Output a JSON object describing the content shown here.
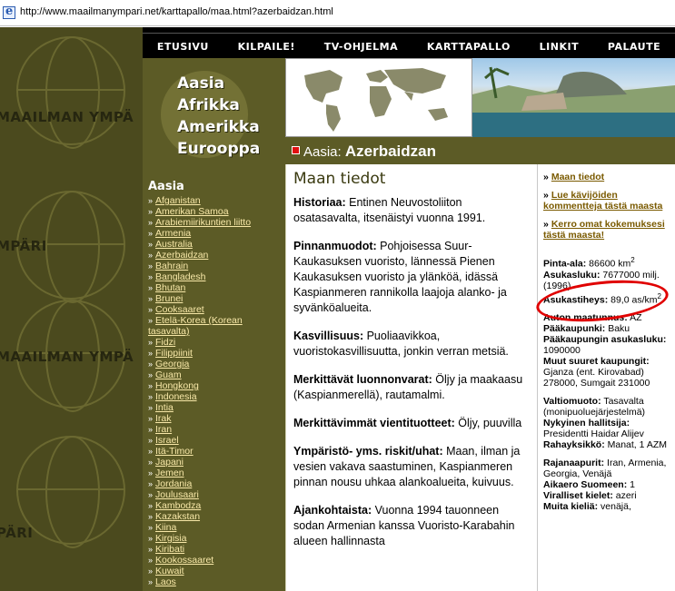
{
  "address_bar": {
    "url": "http://www.maailmanympari.net/karttapallo/maa.html?azerbaidzan.html"
  },
  "left_strip": {
    "pattern_texts": [
      "MAAILMAN YMPÄ",
      "MPÄRI",
      "MAAILMAN YMPÄ",
      "PÄRI"
    ]
  },
  "top_nav": {
    "items": [
      "ETUSIVU",
      "KILPAILE!",
      "TV-OHJELMA",
      "KARTTAPALLO",
      "LINKIT",
      "PALAUTE"
    ]
  },
  "continents": [
    "Aasia",
    "Afrikka",
    "Amerikka",
    "Eurooppa"
  ],
  "breadcrumb": {
    "region": "Aasia:",
    "country": "Azerbaidzan"
  },
  "country_list": {
    "title": "Aasia",
    "items": [
      "Afganistan",
      "Amerikan Samoa",
      "Arabiemiirikuntien liitto",
      "Armenia",
      "Australia",
      "Azerbaidzan",
      "Bahrain",
      "Bangladesh",
      "Bhutan",
      "Brunei",
      "Cooksaaret",
      "Etelä-Korea (Korean",
      "tasavalta)",
      "Fidzi",
      "Filippiinit",
      "Georgia",
      "Guam",
      "Hongkong",
      "Indonesia",
      "Intia",
      "Irak",
      "Iran",
      "Israel",
      "Itä-Timor",
      "Japani",
      "Jemen",
      "Jordania",
      "Joulusaari",
      "Kambodza",
      "Kazakstan",
      "Kiina",
      "Kirgisia",
      "Kiribati",
      "Kookossaaret",
      "Kuwait",
      "Laos"
    ]
  },
  "main": {
    "heading": "Maan tiedot",
    "sections": [
      {
        "label": "Historiaa:",
        "text": " Entinen Neuvostoliiton osatasavalta, itsenäistyi vuonna 1991."
      },
      {
        "label": "Pinnanmuodot:",
        "text": " Pohjoisessa Suur-Kaukasuksen vuoristo, lännessä Pienen Kaukasuksen vuoristo ja ylänköä, idässä Kaspianmeren rannikolla laajoja alanko- ja syvänköalueita."
      },
      {
        "label": "Kasvillisuus:",
        "text": " Puoliaavikkoa, vuoristokasvillisuutta, jonkin verran metsiä."
      },
      {
        "label": "Merkittävät luonnonvarat:",
        "text": " Öljy ja maakaasu (Kaspianmerellä), rautamalmi."
      },
      {
        "label": "Merkittävimmät vientituotteet:",
        "text": " Öljy, puuvilla"
      },
      {
        "label": "Ympäristö- yms. riskit/uhat:",
        "text": " Maan, ilman ja vesien vakava saastuminen, Kaspianmeren pinnan nousu uhkaa alankoalueita, kuivuus."
      },
      {
        "label": "Ajankohtaista:",
        "text": " Vuonna 1994 tauonneen sodan Armenian kanssa Vuoristo-Karabahin alueen hallinnasta"
      }
    ]
  },
  "sidebar": {
    "links": [
      "Maan tiedot",
      "Lue kävijöiden kommentteja tästä maasta",
      "Kerro omat kokemuksesi tästä maasta!"
    ],
    "facts1": [
      {
        "label": "Pinta-ala:",
        "value": " 86600 km",
        "sup": "2"
      },
      {
        "label": "Asukasluku:",
        "value": " 7677000 milj. (1996)"
      },
      {
        "label": "Asukastiheys:",
        "value": " 89,0 as/km",
        "sup": "2"
      }
    ],
    "facts2": [
      {
        "label": "Auton maatunnus:",
        "value": " AZ"
      },
      {
        "label": "Pääkaupunki:",
        "value": " Baku"
      },
      {
        "label": "Pääkaupungin asukasluku:",
        "value": " 1090000"
      },
      {
        "label": "Muut suuret kaupungit:",
        "value": " Gjanza (ent. Kirovabad) 278000, Sumgait 231000"
      }
    ],
    "facts3": [
      {
        "label": "Valtiomuoto:",
        "value": " Tasavalta (monipuoluejärjestelmä)"
      },
      {
        "label": "Nykyinen hallitsija:",
        "value": " Presidentti Haidar Alijev"
      },
      {
        "label": "Rahayksikkö:",
        "value": " Manat, 1 AZM"
      }
    ],
    "facts4": [
      {
        "label": "Rajanaapurit:",
        "value": " Iran, Armenia, Georgia, Venäjä"
      },
      {
        "label": "Aikaero Suomeen:",
        "value": " 1"
      },
      {
        "label": "Viralliset kielet:",
        "value": " azeri"
      },
      {
        "label": "Muita kieliä:",
        "value": " venäjä,"
      }
    ]
  }
}
